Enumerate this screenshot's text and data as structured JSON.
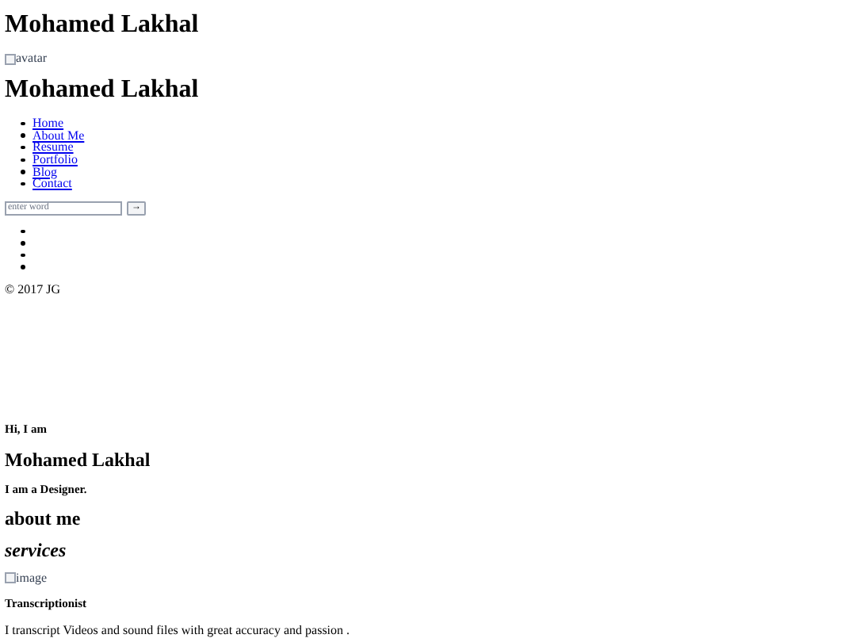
{
  "site_title": "Mohamed Lakhal",
  "avatar": {
    "alt": "avatar"
  },
  "name_heading": "Mohamed Lakhal",
  "nav": [
    {
      "label": "Home"
    },
    {
      "label": "About Me"
    },
    {
      "label": "Resume"
    },
    {
      "label": "Portfolio"
    },
    {
      "label": "Blog"
    },
    {
      "label": "Contact"
    }
  ],
  "search": {
    "placeholder": "enter word",
    "button": "→"
  },
  "social_links": [
    {
      "kind": "bullet"
    },
    {
      "kind": "bullet"
    },
    {
      "kind": "bullet"
    },
    {
      "kind": "bullet"
    }
  ],
  "copyright": "© 2017 JG",
  "intro": {
    "greeting": "Hi, I am",
    "name": "Mohamed Lakhal",
    "role": "I am a Designer."
  },
  "about_heading": "about me",
  "services_heading": "services",
  "service": {
    "image_alt": "image",
    "title": "Transcriptionist",
    "description": "I transcript Videos and sound files with great accuracy and passion ."
  }
}
